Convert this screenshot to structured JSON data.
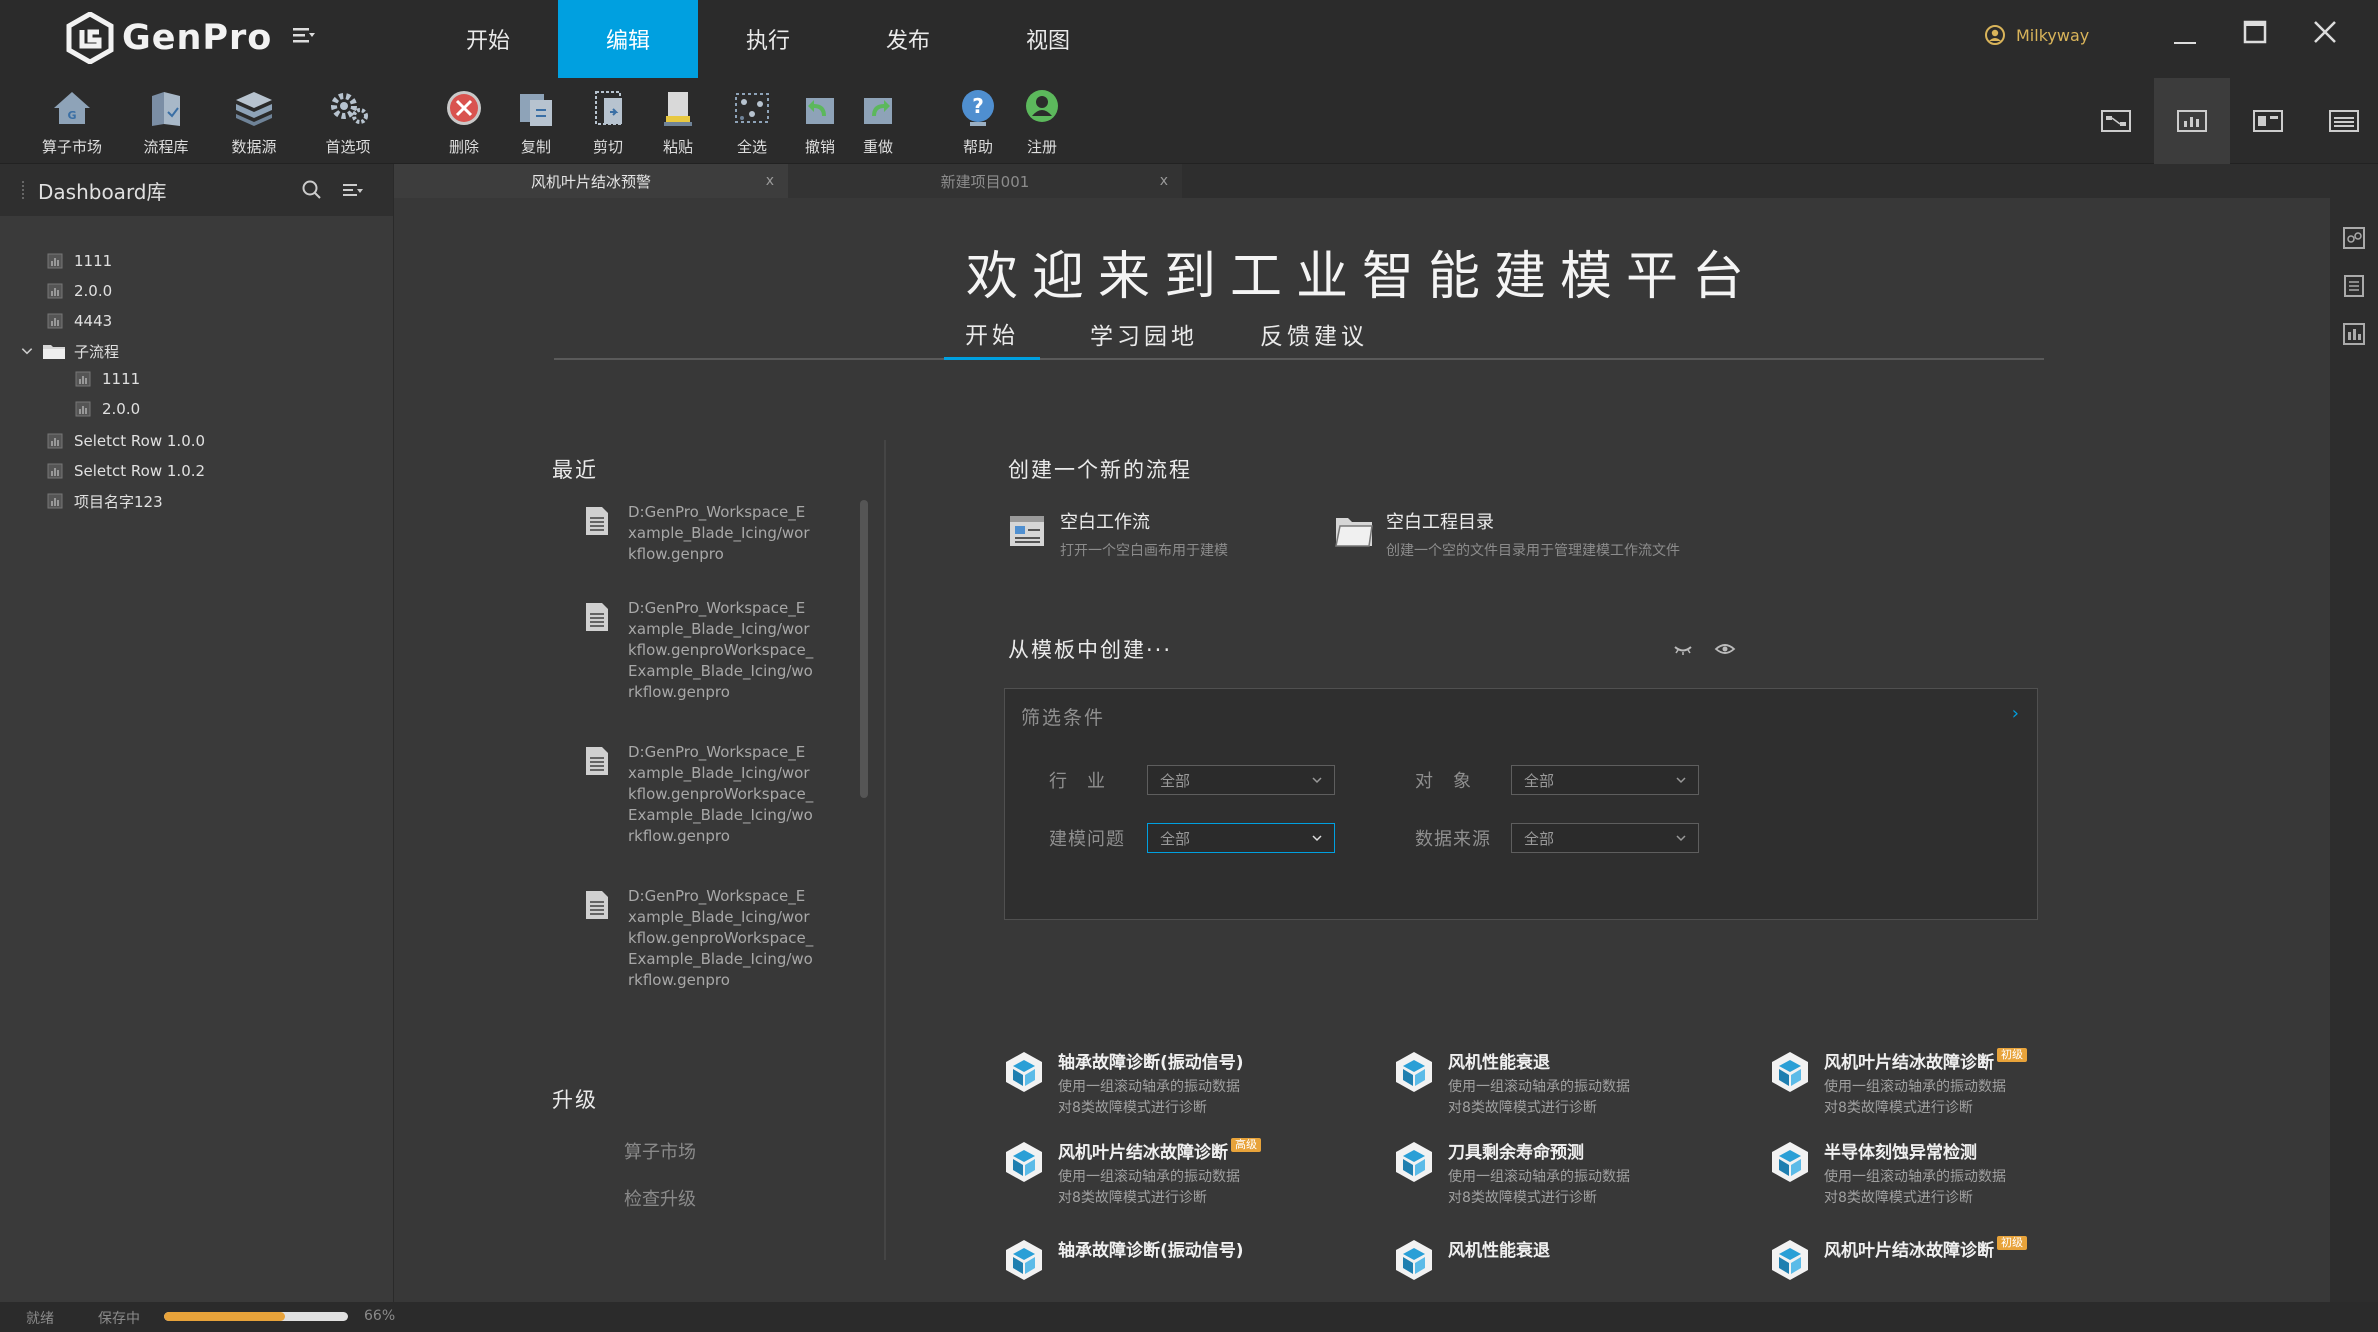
{
  "app": {
    "logo_text": "GenPro"
  },
  "menu": [
    {
      "label": "开始",
      "active": false
    },
    {
      "label": "编辑",
      "active": true
    },
    {
      "label": "执行",
      "active": false
    },
    {
      "label": "发布",
      "active": false
    },
    {
      "label": "视图",
      "active": false
    }
  ],
  "user": {
    "name": "Milkyway"
  },
  "toolbar": {
    "groupA": [
      {
        "label": "算子市场",
        "icon": "house-icon"
      },
      {
        "label": "流程库",
        "icon": "flow-library-icon"
      },
      {
        "label": "数据源",
        "icon": "database-icon"
      },
      {
        "label": "首选项",
        "icon": "gear-icon"
      }
    ],
    "groupB": [
      {
        "label": "删除",
        "icon": "delete-icon"
      },
      {
        "label": "复制",
        "icon": "copy-icon"
      },
      {
        "label": "剪切",
        "icon": "cut-icon"
      },
      {
        "label": "粘贴",
        "icon": "paste-icon"
      },
      {
        "label": "全选",
        "icon": "select-all-icon"
      },
      {
        "label": "撤销",
        "icon": "undo-icon"
      },
      {
        "label": "重做",
        "icon": "redo-icon"
      }
    ],
    "groupC": [
      {
        "label": "帮助",
        "icon": "help-icon"
      },
      {
        "label": "注册",
        "icon": "register-icon"
      }
    ]
  },
  "sidebar": {
    "title": "Dashboard库",
    "items": [
      "1111",
      "2.0.0",
      "4443"
    ],
    "folder": {
      "label": "子流程",
      "children": [
        "1111",
        "2.0.0"
      ]
    },
    "items_after": [
      "Seletct Row 1.0.0",
      "Seletct Row 1.0.2",
      "项目名字123"
    ]
  },
  "doc_tabs": [
    {
      "label": "风机叶片结冰预警",
      "close": "x",
      "active": true
    },
    {
      "label": "新建项目001",
      "close": "x",
      "active": false
    }
  ],
  "main": {
    "welcome": "欢迎来到工业智能建模平台",
    "subtabs": [
      "开始",
      "学习园地",
      "反馈建议"
    ],
    "recent_title": "最近",
    "recent_files": [
      "D:GenPro_Workspace_Example_Blade_Icing/workflow.genpro",
      "D:GenPro_Workspace_Example_Blade_Icing/workflow.genproWorkspace_Example_Blade_Icing/workflow.genpro",
      "D:GenPro_Workspace_Example_Blade_Icing/workflow.genproWorkspace_Example_Blade_Icing/workflow.genpro",
      "D:GenPro_Workspace_Example_Blade_Icing/workflow.genproWorkspace_Example_Blade_Icing/workflow.genpro"
    ],
    "upgrade_title": "升级",
    "upgrade_links": [
      "算子市场",
      "检查升级"
    ],
    "create_title": "创建一个新的流程",
    "create_items": [
      {
        "title": "空白工作流",
        "desc": "打开一个空白画布用于建模"
      },
      {
        "title": "空白工程目录",
        "desc": "创建一个空的文件目录用于管理建模工作流文件"
      }
    ],
    "template_title": "从模板中创建···",
    "filter": {
      "title": "筛选条件",
      "chevron": "›",
      "industry": {
        "label": "行　业",
        "value": "全部"
      },
      "object": {
        "label": "对　象",
        "value": "全部"
      },
      "problem": {
        "label": "建模问题",
        "value": "全部"
      },
      "source": {
        "label": "数据来源",
        "value": "全部"
      }
    },
    "templates": [
      {
        "title": "轴承故障诊断(振动信号)",
        "badge": "",
        "desc": "使用一组滚动轴承的振动数据对8类故障模式进行诊断"
      },
      {
        "title": "风机性能衰退",
        "badge": "",
        "desc": "使用一组滚动轴承的振动数据对8类故障模式进行诊断"
      },
      {
        "title": "风机叶片结冰故障诊断",
        "badge": "初级",
        "desc": "使用一组滚动轴承的振动数据对8类故障模式进行诊断"
      },
      {
        "title": "风机叶片结冰故障诊断",
        "badge": "高级",
        "desc": "使用一组滚动轴承的振动数据对8类故障模式进行诊断"
      },
      {
        "title": "刀具剩余寿命预测",
        "badge": "",
        "desc": "使用一组滚动轴承的振动数据对8类故障模式进行诊断"
      },
      {
        "title": "半导体刻蚀异常检测",
        "badge": "",
        "desc": "使用一组滚动轴承的振动数据对8类故障模式进行诊断"
      },
      {
        "title": "轴承故障诊断(振动信号)",
        "badge": "",
        "desc": ""
      },
      {
        "title": "风机性能衰退",
        "badge": "",
        "desc": ""
      },
      {
        "title": "风机叶片结冰故障诊断",
        "badge": "初级",
        "desc": ""
      }
    ]
  },
  "status": {
    "ready": "就绪",
    "saving": "保存中",
    "progress": 66,
    "progress_text": "66%"
  },
  "colors": {
    "accent": "#00a0e0",
    "badge": "#e8a33a",
    "user": "#d9b45a"
  }
}
